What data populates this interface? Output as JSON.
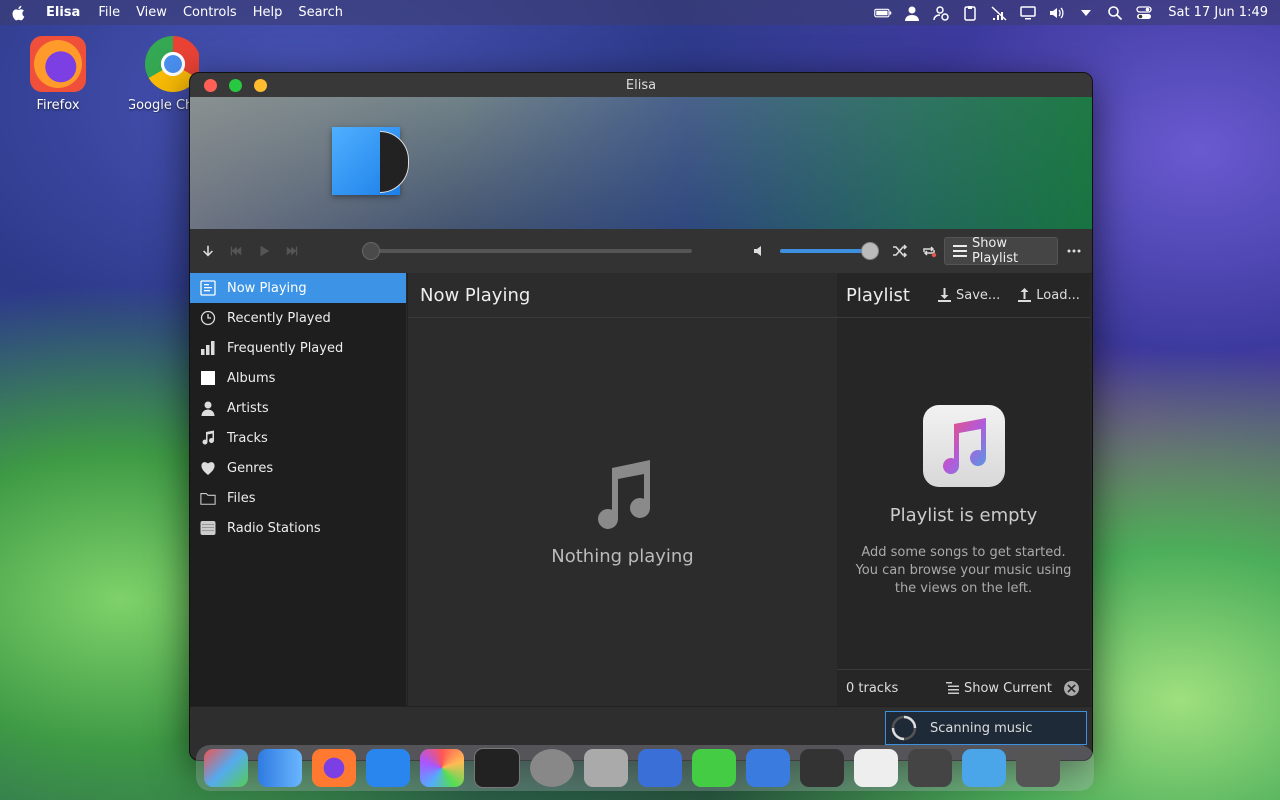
{
  "menubar": {
    "app_name": "Elisa",
    "menus": [
      "File",
      "View",
      "Controls",
      "Help",
      "Search"
    ],
    "clock": "Sat 17 Jun 1:49"
  },
  "desktop": {
    "icons": [
      {
        "label": "Firefox"
      },
      {
        "label": "Google Ch"
      }
    ]
  },
  "window": {
    "title": "Elisa",
    "controls": {
      "show_playlist": "Show Playlist",
      "progress": 0,
      "volume": 1.0
    },
    "sidebar": {
      "items": [
        {
          "label": "Now Playing",
          "icon": "now-playing-icon",
          "active": true
        },
        {
          "label": "Recently Played",
          "icon": "clock-icon"
        },
        {
          "label": "Frequently Played",
          "icon": "bar-chart-icon"
        },
        {
          "label": "Albums",
          "icon": "album-icon"
        },
        {
          "label": "Artists",
          "icon": "person-icon"
        },
        {
          "label": "Tracks",
          "icon": "music-note-icon"
        },
        {
          "label": "Genres",
          "icon": "genre-icon"
        },
        {
          "label": "Files",
          "icon": "folder-icon"
        },
        {
          "label": "Radio Stations",
          "icon": "radio-icon"
        }
      ]
    },
    "center": {
      "title": "Now Playing",
      "empty_text": "Nothing playing"
    },
    "playlist": {
      "title": "Playlist",
      "save": "Save...",
      "load": "Load...",
      "empty_title": "Playlist is empty",
      "empty_desc": "Add some songs to get started. You can browse your music using the views on the left.",
      "track_count": "0 tracks",
      "show_current": "Show Current"
    },
    "status": {
      "scanning": "Scanning music"
    }
  },
  "colors": {
    "accent": "#3d94e6",
    "close": "#ff5f57",
    "minimize": "#febc2e",
    "maximize": "#28c840"
  }
}
